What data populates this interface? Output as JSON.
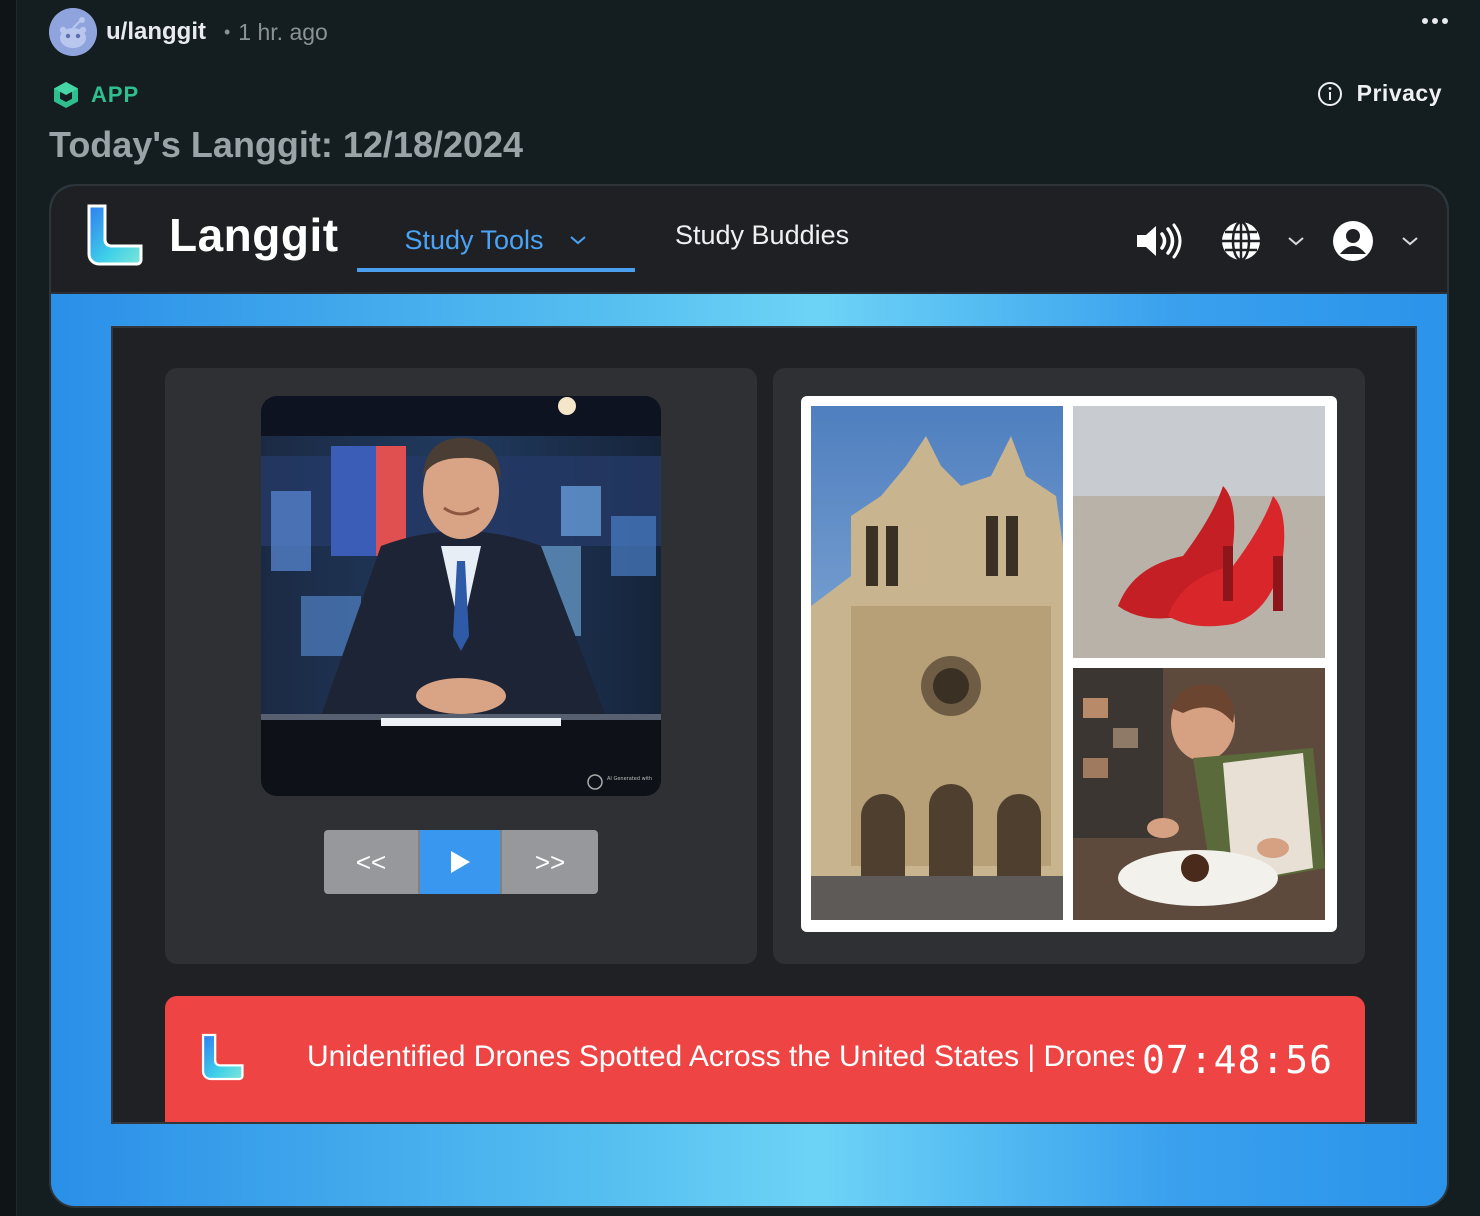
{
  "post": {
    "username": "u/langgit",
    "separator": "•",
    "time_ago": "1 hr. ago",
    "app_label": "APP",
    "privacy_label": "Privacy",
    "title": "Today's Langgit: 12/18/2024"
  },
  "app": {
    "brand": "Langgit",
    "tabs": [
      {
        "label": "Study Tools",
        "active": true,
        "has_dropdown": true
      },
      {
        "label": "Study Buddies",
        "active": false
      }
    ],
    "icons": [
      "speaker-icon",
      "globe-icon",
      "chevron-down-icon",
      "user-icon",
      "chevron-down-icon"
    ]
  },
  "player": {
    "prev_label": "<<",
    "next_label": ">>",
    "watermark": "AI Generated with"
  },
  "ticker": {
    "headline": "Unidentified Drones Spotted Across the United States | Drones",
    "clock": "07:48:56"
  },
  "colors": {
    "accent": "#4aa3f5",
    "ticker_bg": "#ef4444",
    "app_green": "#2fbf8f"
  }
}
